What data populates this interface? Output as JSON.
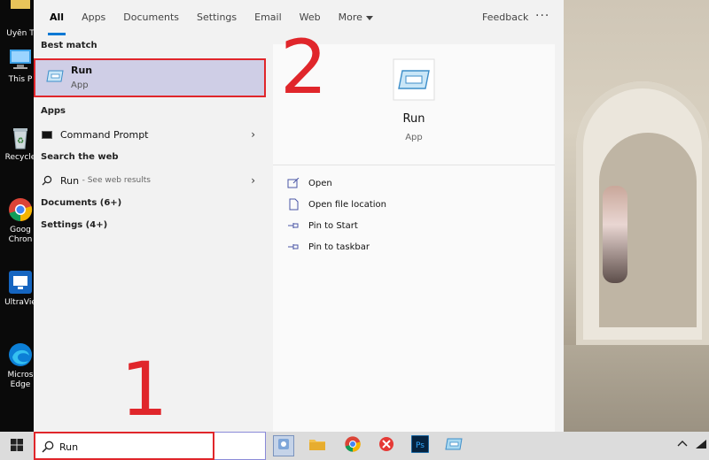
{
  "desktop": {
    "icons": [
      {
        "label": "Uyên T"
      },
      {
        "label": "This P"
      },
      {
        "label": "Recycle"
      },
      {
        "label": "Goog",
        "label2": "Chron"
      },
      {
        "label": "UltraVie"
      },
      {
        "label": "Micros",
        "label2": "Edge"
      }
    ]
  },
  "tabs": [
    "All",
    "Apps",
    "Documents",
    "Settings",
    "Email",
    "Web",
    "More"
  ],
  "header": {
    "feedback": "Feedback",
    "more_dots": "···"
  },
  "sections": {
    "best_match": "Best match",
    "apps": "Apps",
    "search_web": "Search the web",
    "documents": "Documents (6+)",
    "settings": "Settings (4+)"
  },
  "best_match": {
    "title": "Run",
    "subtitle": "App"
  },
  "apps": [
    {
      "label": "Command Prompt"
    }
  ],
  "web": {
    "query": "Run",
    "suffix": "- See web results"
  },
  "preview": {
    "title": "Run",
    "subtitle": "App"
  },
  "actions": [
    "Open",
    "Open file location",
    "Pin to Start",
    "Pin to taskbar"
  ],
  "annotations": {
    "one": "1",
    "two": "2"
  },
  "search": {
    "value": "Run"
  },
  "colors": {
    "accent": "#0078d4",
    "highlight_border": "#e0262b",
    "selected_bg": "#cfcee6"
  }
}
